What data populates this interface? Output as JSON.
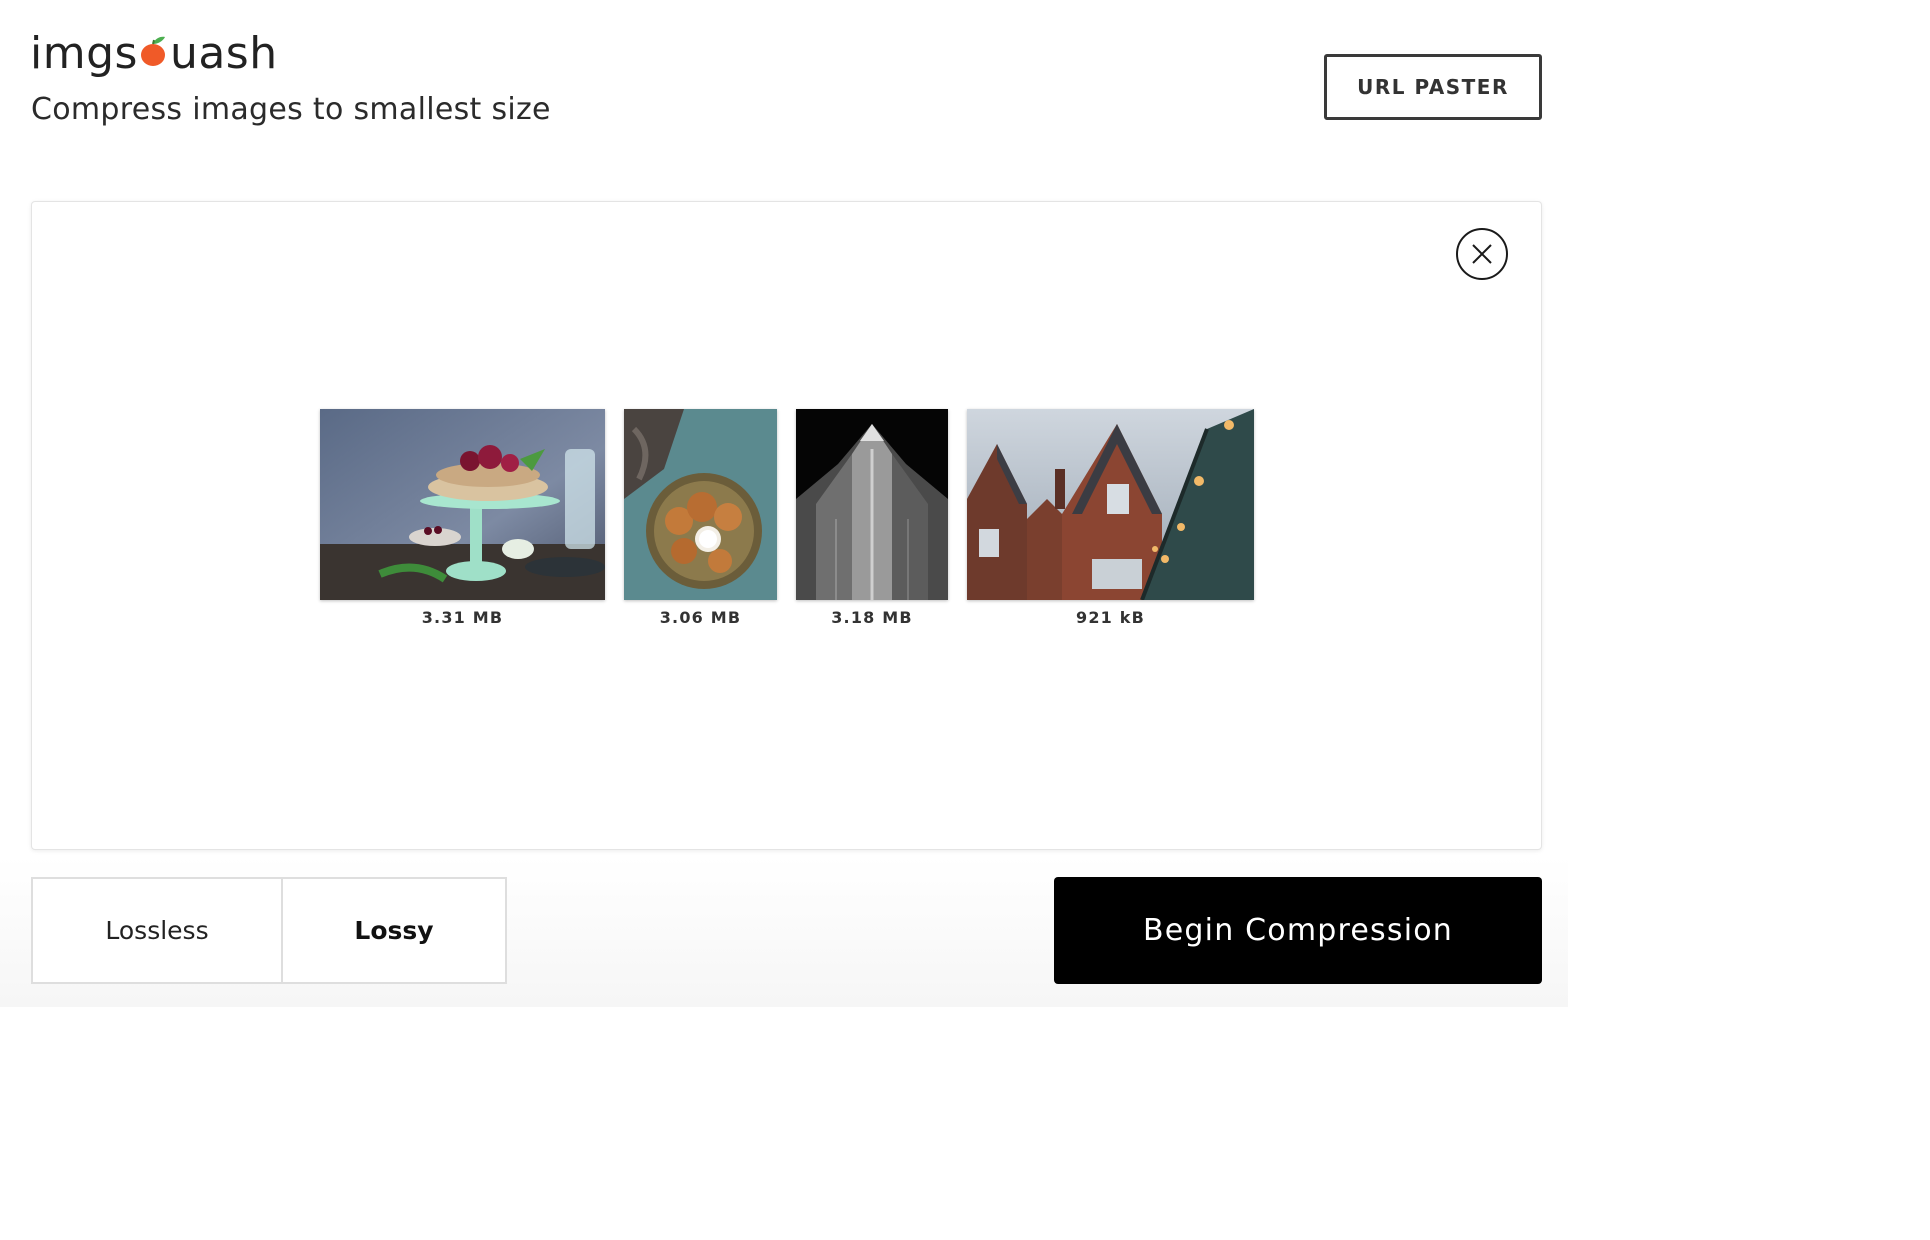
{
  "header": {
    "logo_left": "imgs",
    "logo_right": "uash",
    "tagline": "Compress images to smallest size",
    "url_paster_label": "URL PASTER"
  },
  "panel": {
    "close_icon": "close-icon",
    "images": [
      {
        "subject": "cake-on-stand-photo",
        "size": "3.31 MB"
      },
      {
        "subject": "cookies-plate-photo",
        "size": "3.06 MB"
      },
      {
        "subject": "tower-bw-photo",
        "size": "3.18 MB"
      },
      {
        "subject": "brick-houses-photo",
        "size": "921 kB"
      }
    ]
  },
  "controls": {
    "mode_options": [
      "Lossless",
      "Lossy"
    ],
    "selected_mode": "Lossy",
    "begin_label": "Begin Compression"
  },
  "colors": {
    "accent_orange": "#f05a28",
    "leaf_green": "#4caf50",
    "primary_button": "#000000"
  }
}
